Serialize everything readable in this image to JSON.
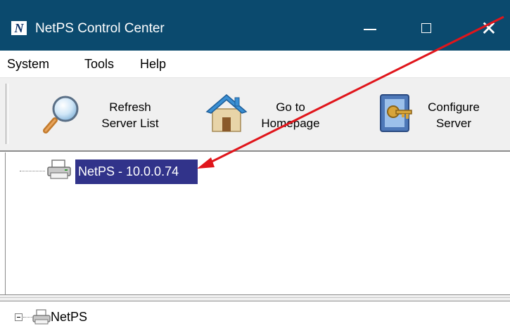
{
  "window": {
    "title": "NetPS Control Center",
    "logo_letter": "N",
    "close_glyph": "✕"
  },
  "menu": [
    "System",
    "Tools",
    "Help"
  ],
  "toolbar": {
    "buttons": [
      {
        "label": "Refresh\nServer List",
        "icon": "magnifier-icon"
      },
      {
        "label": "Go to\nHomepage",
        "icon": "house-icon"
      },
      {
        "label": "Configure\nServer",
        "icon": "configure-server-icon"
      }
    ]
  },
  "tree": {
    "items": [
      {
        "label": "NetPS - 10.0.0.74",
        "icon": "printer-icon",
        "selected": true
      }
    ]
  },
  "bottom_tree": {
    "items": [
      {
        "label": "NetPS",
        "icon": "printer-icon",
        "expanded": true
      }
    ]
  },
  "colors": {
    "titlebar": "#0b4a6e",
    "selection": "#31338a",
    "annotation_arrow": "#e0151b"
  }
}
